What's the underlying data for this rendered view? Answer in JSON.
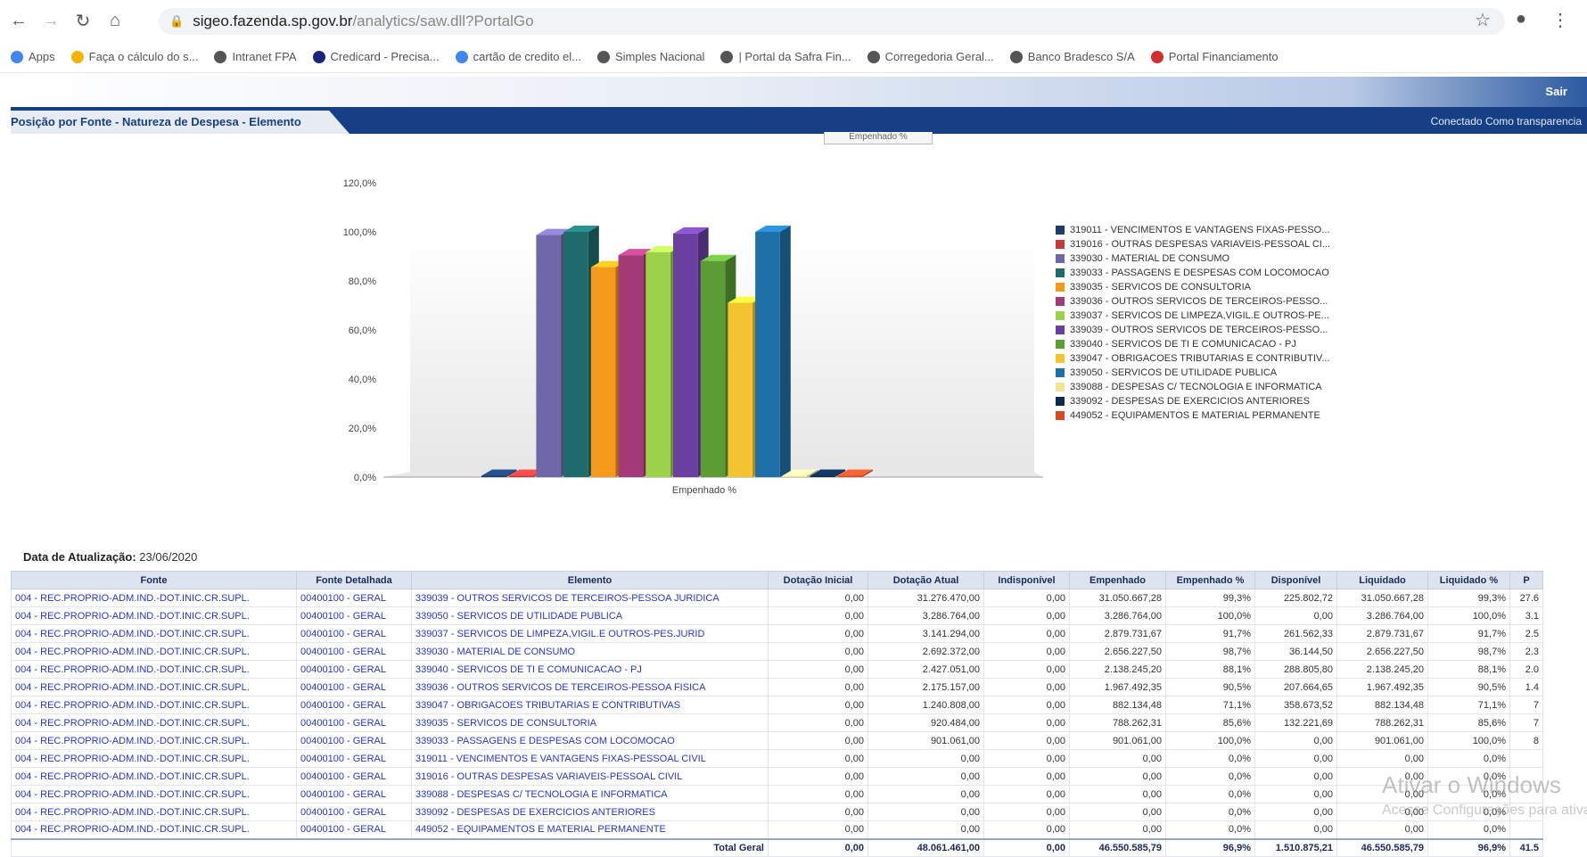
{
  "browser": {
    "url_host": "sigeo.fazenda.sp.gov.br",
    "url_path": "/analytics/saw.dll?PortalGo",
    "bookmarks": [
      {
        "label": "Apps",
        "color": "#4285f4"
      },
      {
        "label": "Faça o cálculo do s...",
        "color": "#f4b400"
      },
      {
        "label": "Intranet FPA",
        "color": "#555555"
      },
      {
        "label": "Credicard - Precisa...",
        "color": "#1a237e"
      },
      {
        "label": "cartão de credito el...",
        "color": "#4285f4"
      },
      {
        "label": "Simples Nacional",
        "color": "#555555"
      },
      {
        "label": "| Portal da Safra Fin...",
        "color": "#555555"
      },
      {
        "label": "Corregedoria Geral...",
        "color": "#555555"
      },
      {
        "label": "Banco Bradesco S/A",
        "color": "#555555"
      },
      {
        "label": "Portal Financiamento",
        "color": "#d32f2f"
      }
    ]
  },
  "header": {
    "sair": "Sair",
    "tab_title": "Posição por Fonte - Natureza de Despesa - Elemento",
    "connected": "Conectado Como  transparencia",
    "chart_select": "Empenhado %"
  },
  "chart_data": {
    "type": "bar",
    "xlabel": "Empenhado %",
    "ylim": [
      0,
      120
    ],
    "yticks": [
      "0,0%",
      "20,0%",
      "40,0%",
      "60,0%",
      "80,0%",
      "100,0%",
      "120,0%"
    ],
    "grid": false,
    "legend_position": "right",
    "series": [
      {
        "name": "319011 - VENCIMENTOS E VANTAGENS FIXAS-PESSO...",
        "value": 0.0,
        "color": "#1c3d6b"
      },
      {
        "name": "319016 - OUTRAS DESPESAS VARIAVEIS-PESSOAL CI...",
        "value": 0.0,
        "color": "#c43a3a"
      },
      {
        "name": "339030 - MATERIAL DE CONSUMO",
        "value": 98.7,
        "color": "#6e67a8"
      },
      {
        "name": "339033 - PASSAGENS E DESPESAS COM LOCOMOCAO",
        "value": 100.0,
        "color": "#1f6b6b"
      },
      {
        "name": "339035 - SERVICOS DE CONSULTORIA",
        "value": 85.6,
        "color": "#f59a1b"
      },
      {
        "name": "339036 - OUTROS SERVICOS DE TERCEIROS-PESSO...",
        "value": 90.5,
        "color": "#a43a78"
      },
      {
        "name": "339037 - SERVICOS DE LIMPEZA,VIGIL.E OUTROS-PE...",
        "value": 91.7,
        "color": "#9bd24a"
      },
      {
        "name": "339039 - OUTROS SERVICOS DE TERCEIROS-PESSO...",
        "value": 99.3,
        "color": "#6a3fa0"
      },
      {
        "name": "339040 - SERVICOS DE TI E COMUNICACAO - PJ",
        "value": 88.1,
        "color": "#5c9c35"
      },
      {
        "name": "339047 - OBRIGACOES TRIBUTARIAS E CONTRIBUTIV...",
        "value": 71.1,
        "color": "#f4c430"
      },
      {
        "name": "339050 - SERVICOS DE UTILIDADE PUBLICA",
        "value": 100.0,
        "color": "#1f6fa8"
      },
      {
        "name": "339088 - DESPESAS C/ TECNOLOGIA E INFORMATICA",
        "value": 0.0,
        "color": "#f1e58f"
      },
      {
        "name": "339092 - DESPESAS DE EXERCICIOS ANTERIORES",
        "value": 0.0,
        "color": "#0d2a4a"
      },
      {
        "name": "449052 - EQUIPAMENTOS E MATERIAL PERMANENTE",
        "value": 0.0,
        "color": "#d64a26"
      }
    ]
  },
  "table": {
    "update_label": "Data de Atualização:",
    "update_date": "23/06/2020",
    "headers": [
      "Fonte",
      "Fonte Detalhada",
      "Elemento",
      "Dotação Inicial",
      "Dotação Atual",
      "Indisponível",
      "Empenhado",
      "Empenhado %",
      "Disponível",
      "Liquidado",
      "Liquidado %",
      "P"
    ],
    "rows": [
      [
        "004 - REC.PROPRIO-ADM.IND.-DOT.INIC.CR.SUPL.",
        "00400100 - GERAL",
        "339039 - OUTROS SERVICOS DE TERCEIROS-PESSOA JURIDICA",
        "0,00",
        "31.276.470,00",
        "0,00",
        "31.050.667,28",
        "99,3%",
        "225.802,72",
        "31.050.667,28",
        "99,3%",
        "27.6"
      ],
      [
        "004 - REC.PROPRIO-ADM.IND.-DOT.INIC.CR.SUPL.",
        "00400100 - GERAL",
        "339050 - SERVICOS DE UTILIDADE PUBLICA",
        "0,00",
        "3.286.764,00",
        "0,00",
        "3.286.764,00",
        "100,0%",
        "0,00",
        "3.286.764,00",
        "100,0%",
        "3.1"
      ],
      [
        "004 - REC.PROPRIO-ADM.IND.-DOT.INIC.CR.SUPL.",
        "00400100 - GERAL",
        "339037 - SERVICOS DE LIMPEZA,VIGIL.E OUTROS-PES.JURID",
        "0,00",
        "3.141.294,00",
        "0,00",
        "2.879.731,67",
        "91,7%",
        "261.562,33",
        "2.879.731,67",
        "91,7%",
        "2.5"
      ],
      [
        "004 - REC.PROPRIO-ADM.IND.-DOT.INIC.CR.SUPL.",
        "00400100 - GERAL",
        "339030 - MATERIAL DE CONSUMO",
        "0,00",
        "2.692.372,00",
        "0,00",
        "2.656.227,50",
        "98,7%",
        "36.144,50",
        "2.656.227,50",
        "98,7%",
        "2.3"
      ],
      [
        "004 - REC.PROPRIO-ADM.IND.-DOT.INIC.CR.SUPL.",
        "00400100 - GERAL",
        "339040 - SERVICOS DE TI E COMUNICACAO - PJ",
        "0,00",
        "2.427.051,00",
        "0,00",
        "2.138.245,20",
        "88,1%",
        "288.805,80",
        "2.138.245,20",
        "88,1%",
        "2.0"
      ],
      [
        "004 - REC.PROPRIO-ADM.IND.-DOT.INIC.CR.SUPL.",
        "00400100 - GERAL",
        "339036 - OUTROS SERVICOS DE TERCEIROS-PESSOA FISICA",
        "0,00",
        "2.175.157,00",
        "0,00",
        "1.967.492,35",
        "90,5%",
        "207.664,65",
        "1.967.492,35",
        "90,5%",
        "1.4"
      ],
      [
        "004 - REC.PROPRIO-ADM.IND.-DOT.INIC.CR.SUPL.",
        "00400100 - GERAL",
        "339047 - OBRIGACOES TRIBUTARIAS E CONTRIBUTIVAS",
        "0,00",
        "1.240.808,00",
        "0,00",
        "882.134,48",
        "71,1%",
        "358.673,52",
        "882.134,48",
        "71,1%",
        "7"
      ],
      [
        "004 - REC.PROPRIO-ADM.IND.-DOT.INIC.CR.SUPL.",
        "00400100 - GERAL",
        "339035 - SERVICOS DE CONSULTORIA",
        "0,00",
        "920.484,00",
        "0,00",
        "788.262,31",
        "85,6%",
        "132.221,69",
        "788.262,31",
        "85,6%",
        "7"
      ],
      [
        "004 - REC.PROPRIO-ADM.IND.-DOT.INIC.CR.SUPL.",
        "00400100 - GERAL",
        "339033 - PASSAGENS E DESPESAS COM LOCOMOCAO",
        "0,00",
        "901.061,00",
        "0,00",
        "901.061,00",
        "100,0%",
        "0,00",
        "901.061,00",
        "100,0%",
        "8"
      ],
      [
        "004 - REC.PROPRIO-ADM.IND.-DOT.INIC.CR.SUPL.",
        "00400100 - GERAL",
        "319011 - VENCIMENTOS E VANTAGENS FIXAS-PESSOAL CIVIL",
        "0,00",
        "0,00",
        "0,00",
        "0,00",
        "0,0%",
        "0,00",
        "0,00",
        "0,0%",
        ""
      ],
      [
        "004 - REC.PROPRIO-ADM.IND.-DOT.INIC.CR.SUPL.",
        "00400100 - GERAL",
        "319016 - OUTRAS DESPESAS VARIAVEIS-PESSOAL CIVIL",
        "0,00",
        "0,00",
        "0,00",
        "0,00",
        "0,0%",
        "0,00",
        "0,00",
        "0,0%",
        ""
      ],
      [
        "004 - REC.PROPRIO-ADM.IND.-DOT.INIC.CR.SUPL.",
        "00400100 - GERAL",
        "339088 - DESPESAS C/ TECNOLOGIA E INFORMATICA",
        "0,00",
        "0,00",
        "0,00",
        "0,00",
        "0,0%",
        "0,00",
        "0,00",
        "0,0%",
        ""
      ],
      [
        "004 - REC.PROPRIO-ADM.IND.-DOT.INIC.CR.SUPL.",
        "00400100 - GERAL",
        "339092 - DESPESAS DE EXERCICIOS ANTERIORES",
        "0,00",
        "0,00",
        "0,00",
        "0,00",
        "0,0%",
        "0,00",
        "0,00",
        "0,0%",
        ""
      ],
      [
        "004 - REC.PROPRIO-ADM.IND.-DOT.INIC.CR.SUPL.",
        "00400100 - GERAL",
        "449052 - EQUIPAMENTOS E MATERIAL PERMANENTE",
        "0,00",
        "0,00",
        "0,00",
        "0,00",
        "0,0%",
        "0,00",
        "0,00",
        "0,0%",
        ""
      ]
    ],
    "total": {
      "label": "Total Geral",
      "values": [
        "0,00",
        "48.061.461,00",
        "0,00",
        "46.550.585,79",
        "96,9%",
        "1.510.875,21",
        "46.550.585,79",
        "96,9%",
        "41.5"
      ]
    }
  },
  "overlay": {
    "watermark": "Ativar o Windows",
    "watermark_sub": "Acesse Configurações para ativar o Windows."
  }
}
